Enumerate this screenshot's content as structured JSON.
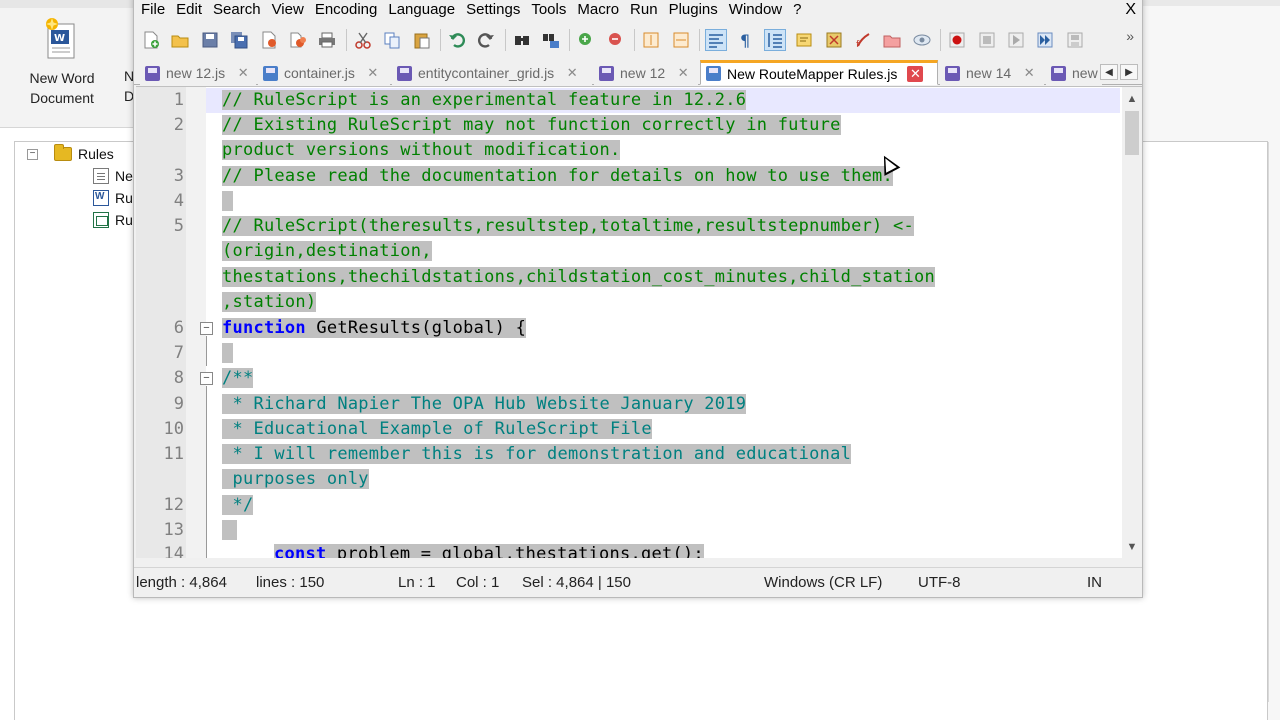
{
  "background": {
    "new_document_label": "New Word Document",
    "fragment_label_1": "N",
    "fragment_label_2": "D",
    "tree": {
      "root_label": "Rules",
      "children": [
        "Ne",
        "Ru",
        "Ru"
      ]
    }
  },
  "window": {
    "menu": [
      "File",
      "Edit",
      "Search",
      "View",
      "Encoding",
      "Language",
      "Settings",
      "Tools",
      "Macro",
      "Run",
      "Plugins",
      "Window",
      "?"
    ],
    "close_glyph": "X",
    "toolbar_more": "»",
    "toolbar_icons": [
      "new-file-icon",
      "open-file-icon",
      "save-icon",
      "save-all-icon",
      "close-icon",
      "close-all-icon",
      "print-icon",
      "cut-icon",
      "copy-icon",
      "paste-icon",
      "undo-icon",
      "redo-icon",
      "find-icon",
      "replace-icon",
      "zoom-in-icon",
      "zoom-out-icon",
      "sync-vertical-icon",
      "sync-horizontal-icon",
      "word-wrap-icon",
      "show-all-chars-icon",
      "indent-guide-icon",
      "doc-map-icon",
      "function-list-icon",
      "folder-workspace-icon",
      "monitoring-icon",
      "record-macro-icon",
      "stop-record-icon",
      "play-macro-icon",
      "run-macro-multiple-icon",
      "save-macro-icon"
    ]
  },
  "tabs": [
    {
      "label": "new 12.js",
      "active": false
    },
    {
      "label": "container.js",
      "active": false
    },
    {
      "label": "entitycontainer_grid.js",
      "active": false
    },
    {
      "label": "new 12",
      "active": false
    },
    {
      "label": "New RouteMapper Rules.js",
      "active": true
    },
    {
      "label": "new 14",
      "active": false
    },
    {
      "label": "new",
      "active": false
    }
  ],
  "tab_close_glyph": "✕",
  "editor": {
    "line_numbers": [
      "1",
      "2",
      "3",
      "4",
      "5",
      "6",
      "7",
      "8",
      "9",
      "10",
      "11",
      "12",
      "13",
      "14"
    ],
    "lines": {
      "l1": "// RuleScript is an experimental feature in 12.2.6",
      "l2a": "// Existing RuleScript may not function correctly in future",
      "l2b": "product versions without modification.",
      "l3": "// Please read the documentation for details on how to use them.",
      "l4": " ",
      "l5a": "// RuleScript(theresults,resultstep,totaltime,resultstepnumber) <-",
      "l5b": "(origin,destination,",
      "l5c": "thestations,thechildstations,childstation_cost_minutes,child_station",
      "l5d": ",station)",
      "l6_kw": "function",
      "l6_rest": " GetResults(global) {",
      "l7": " ",
      "l8": "/**",
      "l9": " * Richard Napier The OPA Hub Website January 2019",
      "l10": " * Educational Example of RuleScript File",
      "l11a": " * I will remember this is for demonstration and educational",
      "l11b": " purposes only",
      "l12": " */",
      "l13": " ",
      "l14_kw": "const",
      "l14_rest": " problem = global.thestations.get();"
    }
  },
  "status": {
    "length": "length : 4,864",
    "lines": "lines : 150",
    "ln": "Ln : 1",
    "col": "Col : 1",
    "sel": "Sel : 4,864 | 150",
    "eol": "Windows (CR LF)",
    "encoding": "UTF-8",
    "mode": "IN"
  },
  "colors": {
    "comment": "#008000",
    "doc_comment": "#008080",
    "keyword": "#0000ff",
    "selection": "#c0c0c0",
    "active_tab_accent": "#f5a623",
    "tab_close_active": "#e0484e"
  }
}
